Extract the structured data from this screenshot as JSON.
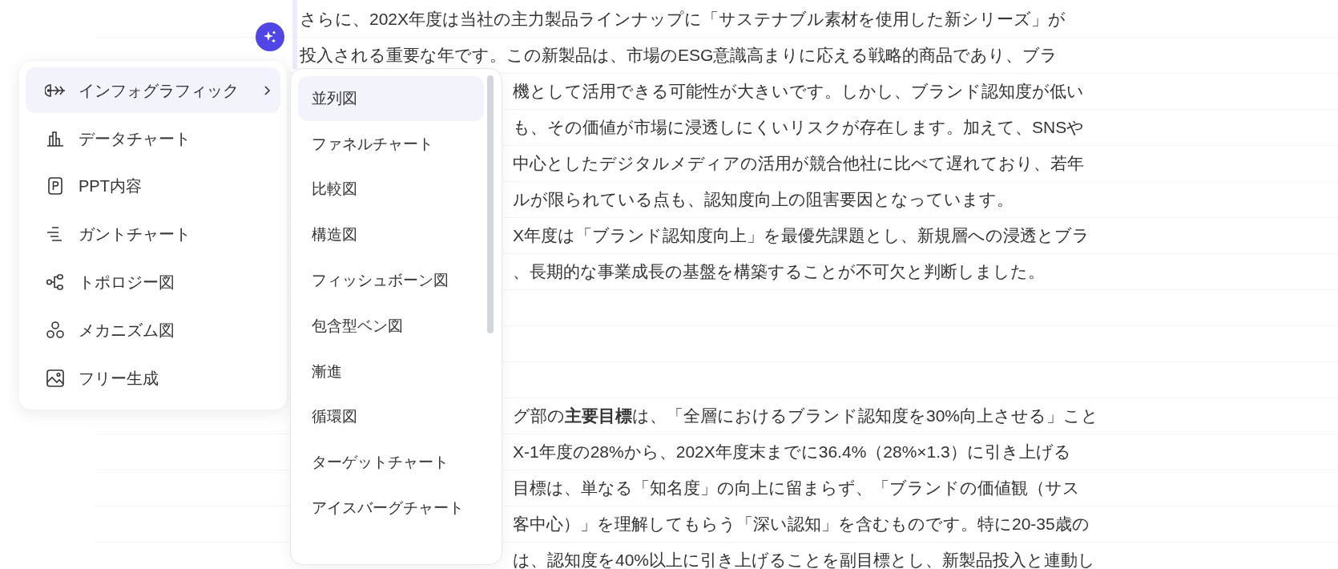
{
  "menu": {
    "items": [
      {
        "label": "インフォグラフィック",
        "selected": true,
        "has_submenu": true
      },
      {
        "label": "データチャート",
        "selected": false,
        "has_submenu": false
      },
      {
        "label": "PPT内容",
        "selected": false,
        "has_submenu": false
      },
      {
        "label": "ガントチャート",
        "selected": false,
        "has_submenu": false
      },
      {
        "label": "トポロジー図",
        "selected": false,
        "has_submenu": false
      },
      {
        "label": "メカニズム図",
        "selected": false,
        "has_submenu": false
      },
      {
        "label": "フリー生成",
        "selected": false,
        "has_submenu": false
      }
    ]
  },
  "submenu": {
    "items": [
      {
        "label": "並列図",
        "selected": true
      },
      {
        "label": "ファネルチャート",
        "selected": false
      },
      {
        "label": "比較図",
        "selected": false
      },
      {
        "label": "構造図",
        "selected": false
      },
      {
        "label": "フィッシュボーン図",
        "selected": false
      },
      {
        "label": "包含型ベン図",
        "selected": false
      },
      {
        "label": "漸進",
        "selected": false
      },
      {
        "label": "循環図",
        "selected": false
      },
      {
        "label": "ターゲットチャート",
        "selected": false
      },
      {
        "label": "アイスバーグチャート",
        "selected": false
      }
    ]
  },
  "document": {
    "lines": [
      {
        "kind": "text",
        "text": "さらに、202X年度は当社の主力製品ラインナップに「サステナブル素材を使用した新シリーズ」が"
      },
      {
        "kind": "text",
        "text": "投入される重要な年です。この新製品は、市場のESG意識高まりに応える戦略的商品であり、ブラ"
      },
      {
        "kind": "text",
        "covered": true,
        "text": "機として活用できる可能性が大きいです。しかし、ブランド認知度が低い"
      },
      {
        "kind": "text",
        "covered": true,
        "text": "も、その価値が市場に浸透しにくいリスクが存在します。加えて、SNSや"
      },
      {
        "kind": "text",
        "covered": true,
        "text": "中心としたデジタルメディアの活用が競合他社に比べて遅れており、若年"
      },
      {
        "kind": "text",
        "covered": true,
        "text": "ルが限られている点も、認知度向上の阻害要因となっています。"
      },
      {
        "kind": "text",
        "covered": true,
        "text": "X年度は「ブランド認知度向上」を最優先課題とし、新規層への浸透とブラ"
      },
      {
        "kind": "text",
        "covered": true,
        "text": "、長期的な事業成長の基盤を構築することが不可欠と判断しました。"
      },
      {
        "kind": "blank"
      },
      {
        "kind": "blank"
      },
      {
        "kind": "blank"
      },
      {
        "kind": "text",
        "covered": true,
        "text": "グ部の**主要目標**は、「全層におけるブランド認知度を30%向上させる」こと"
      },
      {
        "kind": "text",
        "covered": true,
        "text": "X-1年度の28%から、202X年度末までに36.4%（28%×1.3）に引き上げる"
      },
      {
        "kind": "text",
        "covered": true,
        "text": "目標は、単なる「知名度」の向上に留まらず、「ブランドの価値観（サス"
      },
      {
        "kind": "text",
        "covered": true,
        "text": "客中心）」を理解してもらう「深い認知」を含むものです。特に20-35歳の"
      },
      {
        "kind": "text",
        "covered": true,
        "text": "は、認知度を40%以上に引き上げることを副目標とし、新製品投入と連動し"
      }
    ]
  }
}
